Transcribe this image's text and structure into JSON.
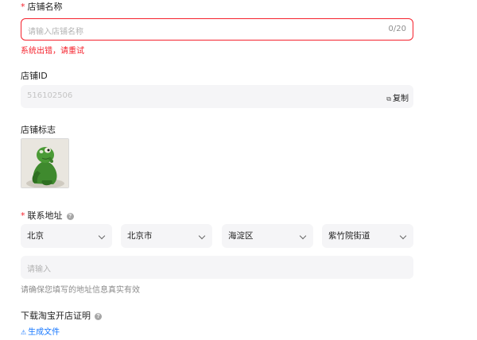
{
  "store_name": {
    "required_mark": "*",
    "label": "店铺名称",
    "placeholder": "请输入店铺名称",
    "counter": "0/20",
    "error": "系统出错，请重试"
  },
  "store_id": {
    "label": "店铺ID",
    "value": "516102506",
    "copy_label": "复制",
    "copy_icon": "copy-icon"
  },
  "store_logo": {
    "label": "店铺标志",
    "image_description": "green-frog-figure"
  },
  "address": {
    "required_mark": "*",
    "label": "联系地址",
    "help_icon": "question-circle-icon",
    "province": "北京",
    "city": "北京市",
    "district": "海淀区",
    "street": "紫竹院街道",
    "detail_placeholder": "请输入",
    "hint": "请确保您填写的地址信息真实有效"
  },
  "certificate": {
    "label": "下载淘宝开店证明",
    "help_icon": "question-circle-icon",
    "action_icon": "warning-icon",
    "action_label": "生成文件"
  },
  "colors": {
    "error": "#f5222d",
    "link": "#1677ff",
    "field_bg": "#f5f5f7",
    "placeholder": "#b3b3b3"
  }
}
